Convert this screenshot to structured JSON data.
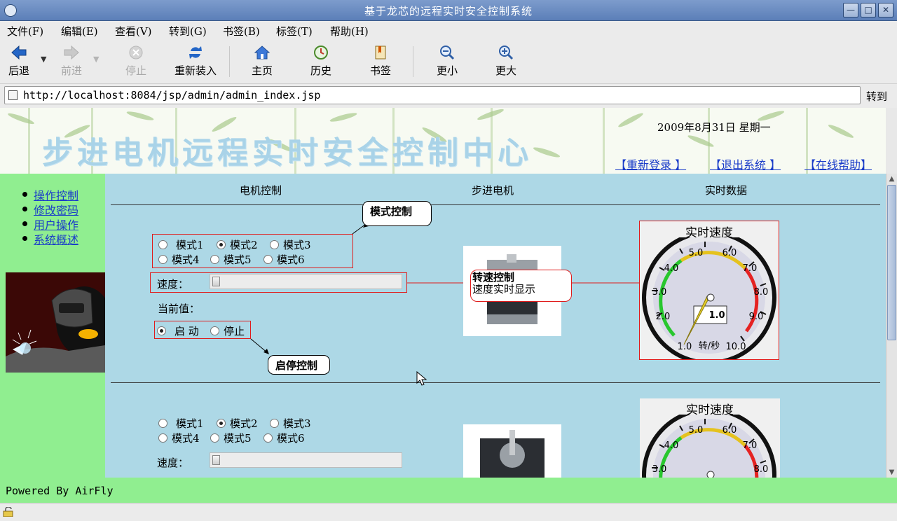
{
  "window": {
    "title": "基于龙芯的远程实时安全控制系统"
  },
  "menu": [
    "文件(F)",
    "编辑(E)",
    "查看(V)",
    "转到(G)",
    "书签(B)",
    "标签(T)",
    "帮助(H)"
  ],
  "toolbar": {
    "back": "后退",
    "forward": "前进",
    "stop": "停止",
    "reload": "重新装入",
    "home": "主页",
    "history": "历史",
    "bookmarks": "书签",
    "zoom_out": "更小",
    "zoom_in": "更大"
  },
  "address": {
    "url": "http://localhost:8084/jsp/admin/admin_index.jsp",
    "go": "转到"
  },
  "banner": {
    "title": "步进电机远程实时安全控制中心",
    "date": "2009年8月31日 星期一",
    "relogin": "【重新登录 】",
    "logout": "【退出系统 】",
    "help": "【在线帮助】"
  },
  "sidebar": {
    "items": [
      "操作控制",
      "修改密码",
      "用户操作",
      "系统概述"
    ]
  },
  "columns": {
    "motor_control": "电机控制",
    "stepper_motor": "步进电机",
    "realtime_data": "实时数据"
  },
  "panel": {
    "modes": [
      "模式1",
      "模式2",
      "模式3",
      "模式4",
      "模式5",
      "模式6"
    ],
    "selected_mode": "模式2",
    "speed_label": "速度：",
    "current_label": "当前值：",
    "start": "启 动",
    "stop": "停止",
    "running": true
  },
  "callouts": {
    "mode_control": "模式控制",
    "speed_control_line1": "转速控制",
    "speed_control_line2": "速度实时显示",
    "start_stop_control": "启停控制"
  },
  "gauge": {
    "title": "实时速度",
    "value": "1.0",
    "unit": "转/秒",
    "ticks": [
      "1.0",
      "2.0",
      "3.0",
      "4.0",
      "5.0",
      "6.0",
      "7.0",
      "8.0",
      "9.0",
      "10.0"
    ],
    "min": 1.0,
    "max": 10.0,
    "reading": 1.0
  },
  "footer": {
    "powered": "Powered By AirFly"
  }
}
